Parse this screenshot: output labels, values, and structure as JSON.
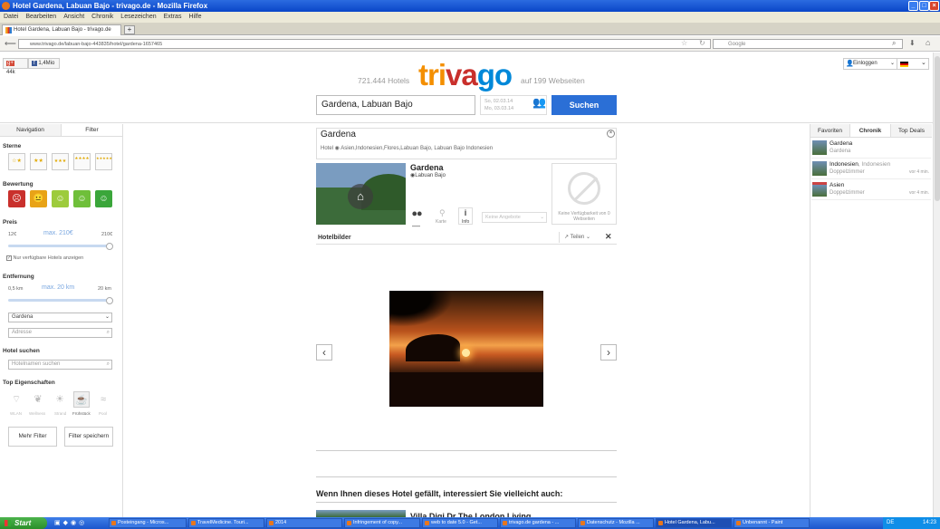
{
  "window": {
    "title": "Hotel Gardena, Labuan Bajo - trivago.de - Mozilla Firefox"
  },
  "menu": [
    "Datei",
    "Bearbeiten",
    "Ansicht",
    "Chronik",
    "Lesezeichen",
    "Extras",
    "Hilfe"
  ],
  "tab": {
    "label": "Hotel Gardena, Labuan Bajo - trivago.de",
    "new": "+"
  },
  "nav": {
    "url": "www.trivago.de/labuan-bajo-443835/hotel/gardena-1657465",
    "search_placeholder": "Google"
  },
  "social": {
    "gplus": "44k",
    "fb": "1,4Mio"
  },
  "header": {
    "logo": "trivago",
    "hotels": "721.444 Hotels",
    "sites": "auf 199 Webseiten",
    "destination": "Gardena, Labuan Bajo",
    "date_from": "So,  02.03.14",
    "date_to": "Mo,  03.03.14",
    "search_button": "Suchen",
    "login": "Einloggen"
  },
  "left": {
    "tabs": [
      "Navigation",
      "Filter"
    ],
    "stars_title": "Sterne",
    "stars": [
      "☆★",
      "★★",
      "★★★",
      "★★★★",
      "★★★★★"
    ],
    "rating_title": "Bewertung",
    "price_title": "Preis",
    "price_min": "12€",
    "price_max_label": "max. 210€",
    "price_max": "210€",
    "price_level": 1.0,
    "only_available": "Nur verfügbare Hotels anzeigen",
    "distance_title": "Entfernung",
    "dist_min": "0,5 km",
    "dist_max_label": "max. 20 km",
    "dist_max": "20 km",
    "distance_level": 1.0,
    "location_value": "Gardena",
    "address_placeholder": "Adresse",
    "hotel_search_title": "Hotel suchen",
    "hotel_search_placeholder": "Hotelnamen suchen",
    "top_features_title": "Top Eigenschaften",
    "features": [
      "WLAN",
      "Wellness",
      "Strand",
      "Frühstück",
      "Pool"
    ],
    "more_filter": "Mehr Filter",
    "save_filter": "Filter speichern"
  },
  "hotel": {
    "name": "Gardena",
    "path": "Hotel  ◉  Asien,Indonesien,Flores,Labuan Bajo, Labuan Bajo Indonesien",
    "title": "Gardena",
    "location": "Labuan Bajo",
    "karte": "Karte",
    "info": "Info",
    "offers_placeholder": "Keine Angebote",
    "no_availability": "Keine Verfügbarkeit von 0 Webseiten",
    "images_title": "Hotelbilder",
    "share": "Teilen",
    "also_like": "Wenn Ihnen dieses Hotel gefällt, interessiert Sie vielleicht auch:",
    "next_hotel": "Villa Digi Dr The London Living"
  },
  "right": {
    "tabs": [
      "Favoriten",
      "Chronik",
      "Top Deals"
    ],
    "items": [
      {
        "title": "Gardena",
        "subtitle": "Gardena",
        "time": ""
      },
      {
        "title": "Indonesien",
        "title2": ", Indonesien",
        "subtitle": "Doppelzimmer",
        "time": "vor 4 min."
      },
      {
        "title": "Asien",
        "subtitle": "Doppelzimmer",
        "time": "vor 4 min."
      }
    ]
  },
  "taskbar": {
    "start": "Start",
    "tasks": [
      "Posteingang - Micros...",
      "TravelMedicine. Touri...",
      "2014",
      "Infringement of copy...",
      "web to date 5.0 - Get...",
      "trivago.de gardena - ...",
      "Datenschutz - Mozilla ...",
      "Hotel Gardena, Labu...",
      "Unbenannt - Paint"
    ],
    "lang": "DE",
    "time": "14:23"
  }
}
